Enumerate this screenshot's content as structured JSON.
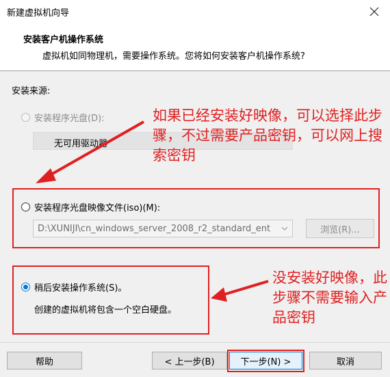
{
  "window": {
    "title": "新建虚拟机向导"
  },
  "header": {
    "title": "安装客户机操作系统",
    "description": "虚拟机如同物理机，需要操作系统。您将如何安装客户机操作系统?"
  },
  "install_source": {
    "label": "安装来源:",
    "option_cd": {
      "label": "安装程序光盘(D):",
      "drive_value": "无可用驱动器",
      "enabled": false,
      "selected": false
    },
    "option_iso": {
      "label": "安装程序光盘映像文件(iso)(M):",
      "path_value": "D:\\XUNIJI\\cn_windows_server_2008_r2_standard_ent",
      "browse_label": "浏览(R)...",
      "selected": false
    },
    "option_later": {
      "label": "稍后安装操作系统(S)。",
      "description": "创建的虚拟机将包含一个空白硬盘。",
      "selected": true
    }
  },
  "annotations": {
    "note_iso": "如果已经安装好映像，可以选择此步骤，不过需要产品密钥，可以网上搜索密钥",
    "note_later": "没安装好映像，此步骤不需要输入产品密钥"
  },
  "footer": {
    "help_label": "帮助",
    "back_label": "< 上一步(B)",
    "next_label": "下一步(N) >",
    "cancel_label": "取消"
  },
  "colors": {
    "annotation_red": "#e02020",
    "accent_blue": "#0078d7"
  }
}
